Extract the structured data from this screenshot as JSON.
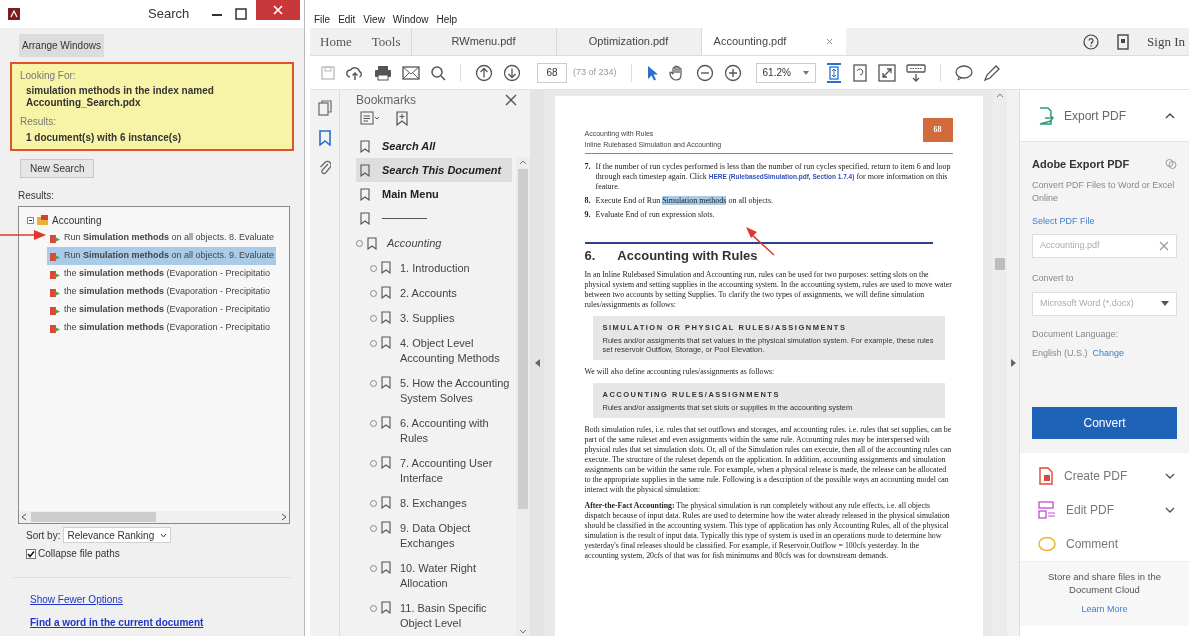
{
  "search_window": {
    "title": "Search",
    "arrange_button": "Arrange Windows",
    "looking_for_label": "Looking For:",
    "query": "simulation methods in the index named Accounting_Search.pdx",
    "results_label": "Results:",
    "results_summary": "1 document(s) with 6 instance(s)",
    "new_search_button": "New Search",
    "results_heading": "Results:",
    "results_tree": {
      "label": "Accounting",
      "children": [
        {
          "label": "Run **Simulation methods** on all objects. 8. Evaluate",
          "selected": false
        },
        {
          "label": "Run **Simulation methods** on all objects. 9. Evaluate",
          "selected": true
        },
        {
          "label": "the **simulation methods** (Evaporation - Precipitatio",
          "selected": false
        },
        {
          "label": "the **simulation methods** (Evaporation - Precipitatio",
          "selected": false
        },
        {
          "label": "the **simulation methods** (Evaporation - Precipitatio",
          "selected": false
        },
        {
          "label": "the **simulation methods** (Evaporation - Precipitatio",
          "selected": false
        }
      ]
    },
    "sort_label": "Sort by:",
    "sort_value": "Relevance Ranking",
    "collapse_paths": {
      "label": "Collapse file paths",
      "checked": true
    },
    "links": [
      {
        "label": "Show Fewer Options",
        "kind": "plain"
      },
      {
        "label": "Find a word in the current document",
        "kind": "bold"
      }
    ]
  },
  "menu": [
    "File",
    "Edit",
    "View",
    "Window",
    "Help"
  ],
  "tabs": [
    {
      "label": "Home",
      "kind": "nav",
      "selected": false
    },
    {
      "label": "Tools",
      "kind": "nav",
      "selected": false
    },
    {
      "label": "RWmenu.pdf",
      "kind": "doc",
      "selected": false
    },
    {
      "label": "Optimization.pdf",
      "kind": "doc",
      "selected": false
    },
    {
      "label": "Accounting.pdf",
      "kind": "doc",
      "selected": true
    }
  ],
  "sign_in": "Sign In",
  "toolbar": {
    "page": "68",
    "page_of": "(73 of 234)",
    "zoom": "61.2%"
  },
  "bookmarks": {
    "title": "Bookmarks",
    "items": [
      {
        "label": "Search All",
        "kind": "search",
        "selected": false
      },
      {
        "label": "Search This Document",
        "kind": "search",
        "selected": true
      },
      {
        "label": "Main Menu",
        "kind": "menu",
        "selected": false
      },
      {
        "kind": "rule",
        "selected": false
      }
    ],
    "outline": {
      "label": "Accounting",
      "children": [
        {
          "label": "1. Introduction"
        },
        {
          "label": "2. Accounts"
        },
        {
          "label": "3. Supplies"
        },
        {
          "label": "4. Object Level Accounting Methods"
        },
        {
          "label": "5. How the Accounting System Solves"
        },
        {
          "label": "6. Accounting with Rules"
        },
        {
          "label": "7. Accounting User Interface"
        },
        {
          "label": "8. Exchanges"
        },
        {
          "label": "9. Data Object Exchanges"
        },
        {
          "label": "10. Water Right Allocation"
        },
        {
          "label": "11. Basin Specific Object Level"
        }
      ]
    }
  },
  "document": {
    "running_header": [
      "Accounting with Rules",
      "Inline Rulebased Simulation and Accounting"
    ],
    "page_badge": "68",
    "steps": [
      {
        "number": "7.",
        "parts": [
          {
            "kind": "plain",
            "text": "If the number of run cycles performed is less than the number of run cycles specified, return to item 6 and loop through each timestep again. Click "
          },
          {
            "kind": "link",
            "text": "HERE (RulebasedSimulation.pdf, Section 1.7.4)"
          },
          {
            "kind": "plain",
            "text": " for more information on this feature."
          }
        ]
      },
      {
        "number": "8.",
        "parts": [
          {
            "kind": "plain",
            "text": "Execute End of Run "
          },
          {
            "kind": "highlight",
            "text": "Simulation methods"
          },
          {
            "kind": "plain",
            "text": " on all objects."
          }
        ]
      },
      {
        "number": "9.",
        "parts": [
          {
            "kind": "plain",
            "text": "Evaluate End of run expression slots."
          }
        ]
      }
    ],
    "section_number": "6.",
    "section_title": "Accounting with Rules",
    "blocks": [
      {
        "kind": "paragraph",
        "text": "In an Inline Rulebased Simulation and Accounting run, rules can be used for two purposes: setting slots on the physical system and setting supplies in the accounting system. In the accounting system, rules are used to move water between two accounts by setting Supplies. To clarify the two types of assignments, we will define simulation rules/assignments as follows:"
      },
      {
        "kind": "callout",
        "title": "SIMULATION OR PHYSICAL RULES/ASSIGNMENTS",
        "text": "Rules and/or assigments that set values in the physical simulation system. For example, these rules set reservoir Outflow, Storage, or Pool Elevation."
      },
      {
        "kind": "paragraph",
        "text": "We will also define accounting rules/assignments as follows:"
      },
      {
        "kind": "callout",
        "title": "ACCOUNTING RULES/ASSIGNMENTS",
        "text": "Rules and/or assigments that set slots or supplies in the accounting system"
      },
      {
        "kind": "paragraph",
        "text": "Both simulation rules, i.e. rules that set outflows and storages, and accounting rules. i.e. rules that set supplies, can be part of the same ruleset and even assignments within the same rule. Accounting rules may be interspersed with physical rules that set simulation slots. Or, all of the Simulation rules can execute, then all of the accounting rules can execute. The structure of the ruleset depends on the application. In addition, accounting assignments and simulation assignments can be within the same rule. For example, when a physical release is made, the release can be allocated to the appropriate supplies in the same rule. Following is a description of the possible ways an accounting model can interact with the physical simulation:"
      },
      {
        "kind": "paragraph",
        "text": "**After-the-Fact Accounting:**  The physical simulation is run completely without any rule effects, i.e. all objects dispatch because of input data. Rules are used to determine how the water already released in the physical simulation should be classified in the accounting system. This type of application has only Accounting Rules, all of the physical simulation is the result of input data. Typically this type of system is used in an operations mode to determine how yesterday's final releases should be classified. For example, if Reservoir.Outflow = 100cfs yesterday. In the accounting system, 20cfs of that was for fish minimums and 80cfs was for downstream demands."
      }
    ]
  },
  "export_panel": {
    "title": "Export PDF",
    "expanded": true,
    "heading": "Adobe Export PDF",
    "description": "Convert PDF Files to Word or Excel Online",
    "select_label": "Select PDF File",
    "file_value": "Accounting.pdf",
    "convert_to_label": "Convert to",
    "convert_to_value": "Microsoft Word (*.docx)",
    "language_label": "Document Language:",
    "language_value": "English (U.S.)",
    "change_link": "Change",
    "convert_button": "Convert"
  },
  "tools": [
    {
      "label": "Create PDF",
      "kind": "create"
    },
    {
      "label": "Edit PDF",
      "kind": "edit"
    },
    {
      "label": "Comment",
      "kind": "comment"
    }
  ],
  "cloud": {
    "text": "Store and share files in the Document Cloud",
    "link": "Learn More"
  }
}
